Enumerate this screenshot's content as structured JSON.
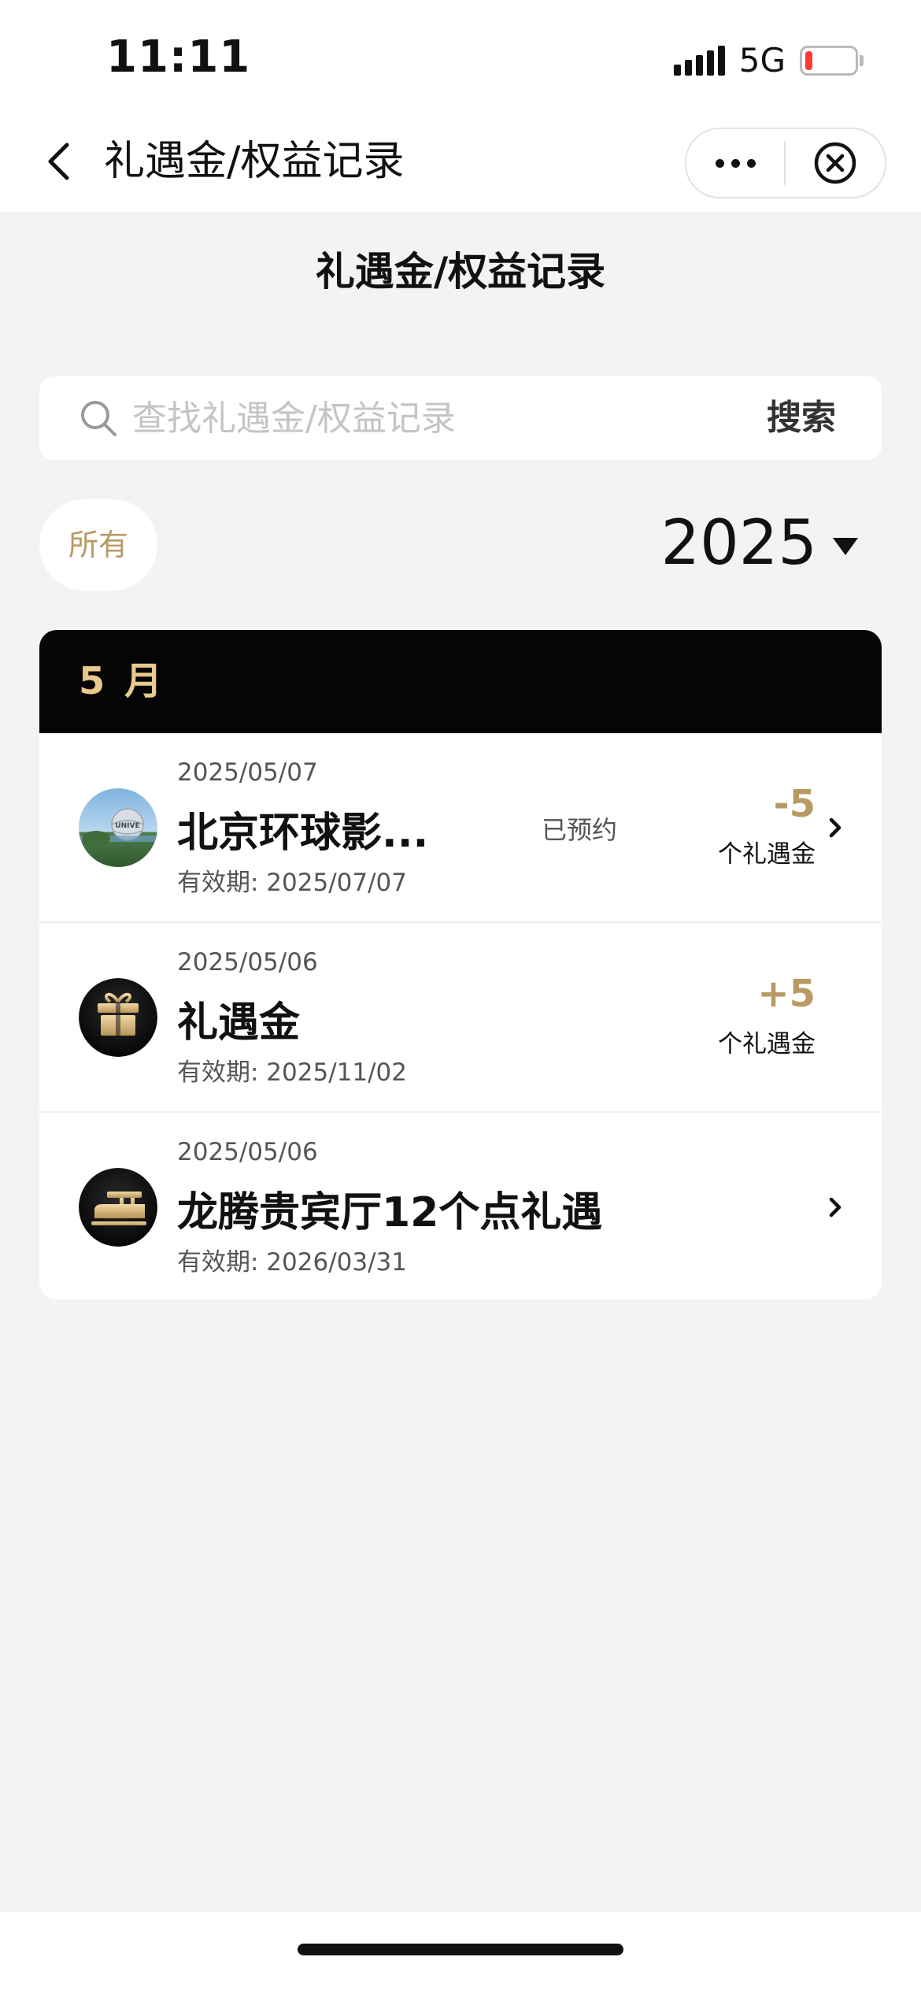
{
  "status_bar": {
    "time": "11:11",
    "network": "5G",
    "battery_level": 0.08
  },
  "nav": {
    "title": "礼遇金/权益记录",
    "back_icon": "chevron-left-icon",
    "more_icon": "more-dots-icon",
    "close_icon": "close-circle-icon"
  },
  "page": {
    "heading": "礼遇金/权益记录"
  },
  "search": {
    "placeholder": "查找礼遇金/权益记录",
    "value": "",
    "button_label": "搜索"
  },
  "filters": {
    "category_label": "所有",
    "year": "2025"
  },
  "colors": {
    "accent_gold": "#b89a63",
    "header_gold": "#e9c98c",
    "header_bg": "#050505",
    "status_red": "#ff3b30"
  },
  "records": {
    "month_label": "5 月",
    "items": [
      {
        "date": "2025/05/07",
        "title": "北京环球影...",
        "valid": "有效期: 2025/07/07",
        "status": "已预约",
        "amount": "-5",
        "unit": "个礼遇金",
        "icon": "universal-globe-icon",
        "has_chevron": true
      },
      {
        "date": "2025/05/06",
        "title": "礼遇金",
        "valid": "有效期: 2025/11/02",
        "status": "",
        "amount": "+5",
        "unit": "个礼遇金",
        "icon": "gift-icon",
        "has_chevron": false
      },
      {
        "date": "2025/05/06",
        "title": "龙腾贵宾厅12个点礼遇",
        "valid": "有效期: 2026/03/31",
        "status": "",
        "amount": "",
        "unit": "",
        "icon": "lounge-sofa-icon",
        "has_chevron": true
      }
    ]
  }
}
